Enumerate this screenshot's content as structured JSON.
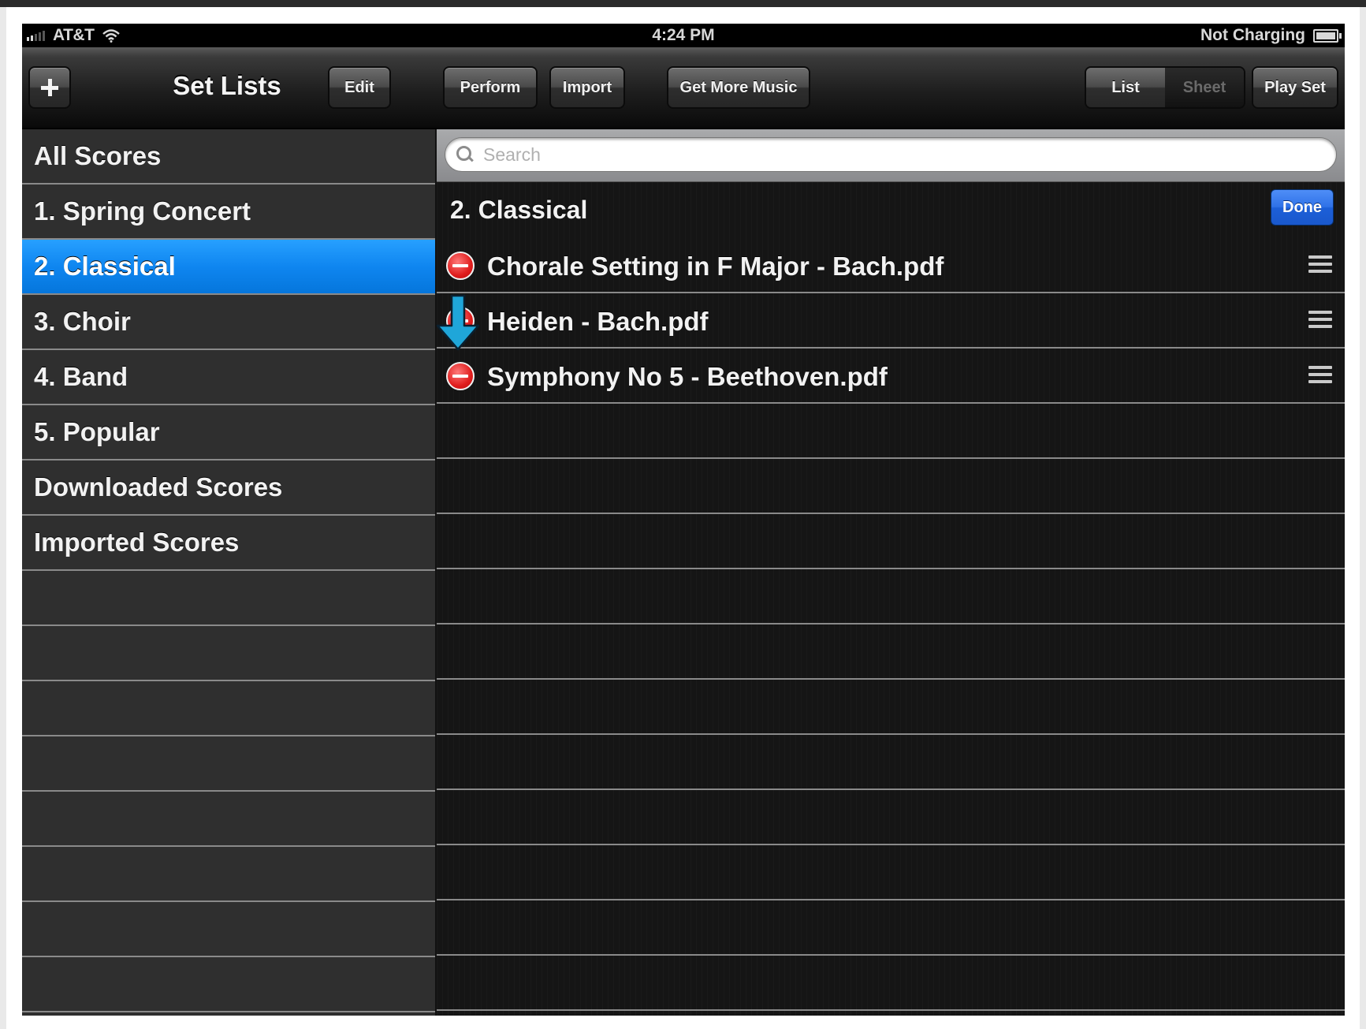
{
  "status_bar": {
    "carrier": "AT&T",
    "time": "4:24 PM",
    "battery_status": "Not Charging"
  },
  "left_nav": {
    "title": "Set Lists",
    "add_icon": "plus-icon",
    "edit_label": "Edit"
  },
  "right_nav": {
    "perform_label": "Perform",
    "import_label": "Import",
    "get_more_music_label": "Get More Music",
    "view_toggle": {
      "list_label": "List",
      "sheet_label": "Sheet",
      "selected": "List"
    },
    "play_set_label": "Play Set"
  },
  "sidebar": {
    "items": [
      {
        "label": "All Scores",
        "selected": false
      },
      {
        "label": "1. Spring Concert",
        "selected": false
      },
      {
        "label": "2. Classical",
        "selected": true
      },
      {
        "label": "3. Choir",
        "selected": false
      },
      {
        "label": "4. Band",
        "selected": false
      },
      {
        "label": "5. Popular",
        "selected": false
      },
      {
        "label": "Downloaded Scores",
        "selected": false
      },
      {
        "label": "Imported Scores",
        "selected": false
      }
    ]
  },
  "search": {
    "placeholder": "Search",
    "value": ""
  },
  "main": {
    "section_title": "2. Classical",
    "done_label": "Done",
    "scores": [
      {
        "title": "Chorale Setting in F Major - Bach.pdf"
      },
      {
        "title": "Heiden - Bach.pdf"
      },
      {
        "title": "Symphony No 5 - Beethoven.pdf"
      }
    ]
  },
  "icons": {
    "delete": "delete-minus-icon",
    "reorder": "reorder-handle-icon",
    "search": "search-icon",
    "annotation": "down-arrow-icon"
  },
  "colors": {
    "selection": "#0f86f0",
    "done_button": "#2f72e8",
    "delete_button": "#e01d1d",
    "annotation_arrow": "#1fa6d9"
  }
}
